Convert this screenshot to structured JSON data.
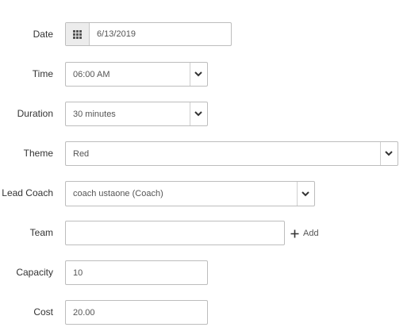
{
  "form": {
    "date": {
      "label": "Date",
      "value": "6/13/2019",
      "button_icon": "calendar-grid-icon"
    },
    "time": {
      "label": "Time",
      "value": "06:00 AM",
      "icon": "chevron-down-icon"
    },
    "duration": {
      "label": "Duration",
      "value": "30 minutes",
      "icon": "chevron-down-icon"
    },
    "theme": {
      "label": "Theme",
      "value": "Red",
      "icon": "chevron-down-icon"
    },
    "lead_coach": {
      "label": "Lead Coach",
      "value": "coach ustaone (Coach)",
      "icon": "chevron-down-icon"
    },
    "team": {
      "label": "Team",
      "value": "",
      "add_label": "Add",
      "add_icon": "plus-icon"
    },
    "capacity": {
      "label": "Capacity",
      "value": "10"
    },
    "cost": {
      "label": "Cost",
      "value": "20.00"
    }
  }
}
